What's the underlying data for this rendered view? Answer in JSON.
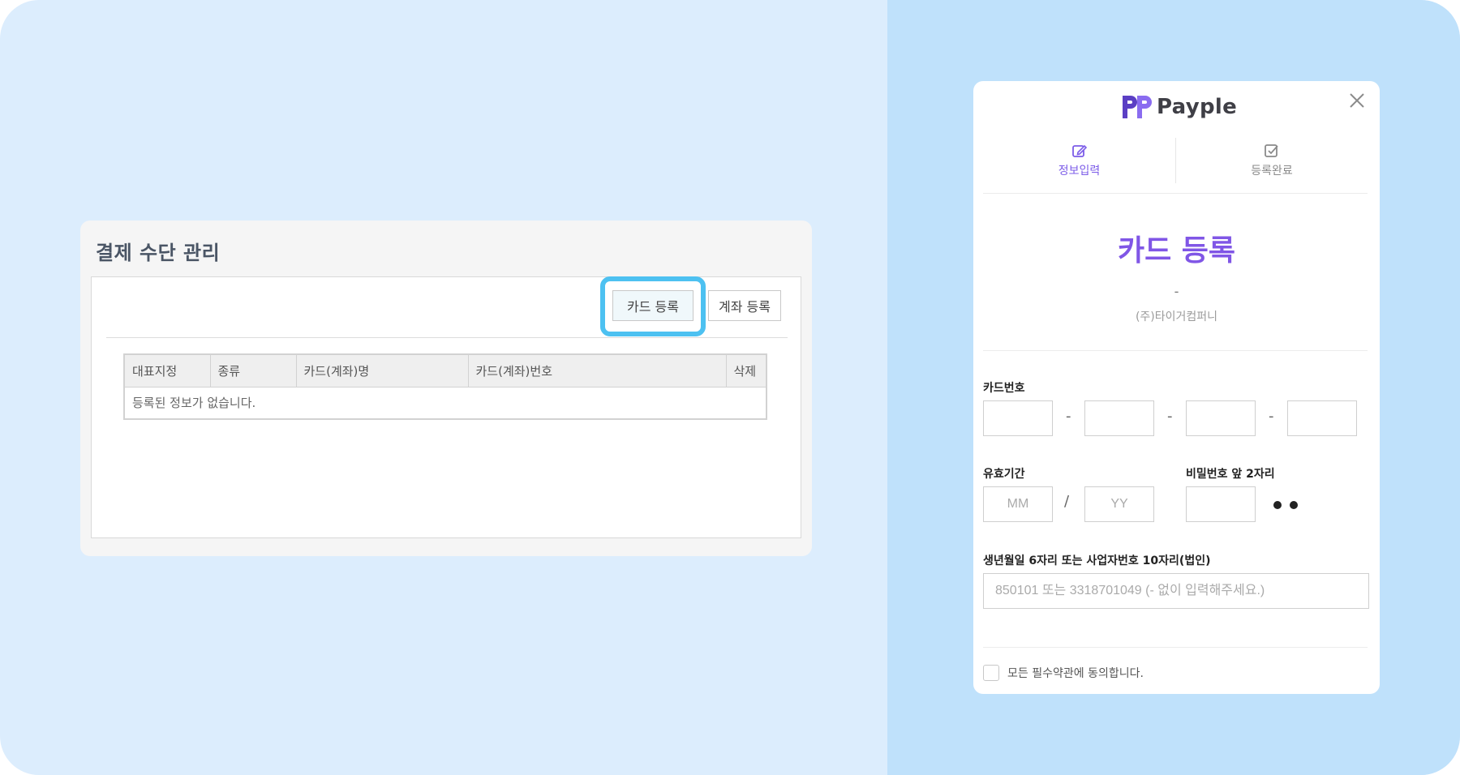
{
  "left": {
    "title": "결제 수단 관리",
    "card_button": "카드 등록",
    "account_button": "계좌 등록",
    "table": {
      "headers": [
        "대표지정",
        "종류",
        "카드(계좌)명",
        "카드(계좌)번호",
        "삭제"
      ],
      "empty_message": "등록된 정보가 없습니다."
    }
  },
  "modal": {
    "logo_text": "Payple",
    "steps": [
      {
        "label": "정보입력",
        "icon": "edit-icon",
        "active": true
      },
      {
        "label": "등록완료",
        "icon": "check-square-icon",
        "active": false
      }
    ],
    "title": "카드 등록",
    "dash": "-",
    "merchant": "(주)타이거컴퍼니",
    "card_number_label": "카드번호",
    "card_number_values": [
      "",
      "",
      "",
      ""
    ],
    "expiry_label": "유효기간",
    "expiry_month_placeholder": "MM",
    "expiry_year_placeholder": "YY",
    "expiry_separator": "/",
    "password_label": "비밀번호 앞 2자리",
    "birth_label": "생년월일 6자리 또는 사업자번호 10자리(법인)",
    "birth_placeholder": "850101 또는 3318701049 (- 없이 입력해주세요.)",
    "agree_text": "모든 필수약관에 동의합니다."
  },
  "colors": {
    "accent": "#8056e6",
    "highlight": "#4dc1f1",
    "left_bg": "#dcedfd",
    "right_bg": "#bfe1fb"
  }
}
